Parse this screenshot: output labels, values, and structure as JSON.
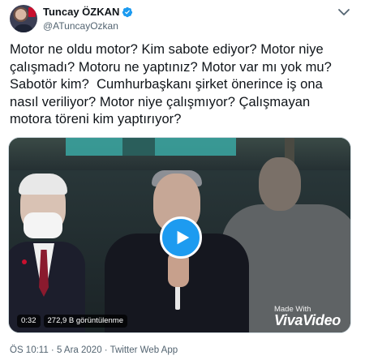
{
  "author": {
    "display_name": "Tuncay ÖZKAN",
    "handle": "@ATuncayOzkan",
    "verified": true,
    "avatar_icon": "profile-photo"
  },
  "tweet": {
    "text": "Motor ne oldu motor? Kim sabote ediyor? Motor niye\nçalışmadı? Motoru ne yaptınız? Motor var mı yok mu?\nSabotör kim?  Cumhurbaşkanı şirket önerince iş ona\nnasıl veriliyor? Motor niye çalışmıyor? Çalışmayan\nmotora töreni kim yaptırıyor?"
  },
  "video": {
    "duration": "0:32",
    "views": "272,9 B görüntülenme",
    "watermark_line1": "Made With",
    "watermark_line2": "VivaVideo",
    "play_icon": "play-icon"
  },
  "meta": {
    "timestamp": "ÖS 10:11 · 5 Ara 2020 · Twitter Web App"
  },
  "colors": {
    "accent": "#1d9bf0",
    "text": "#0f1419",
    "muted": "#536471"
  }
}
